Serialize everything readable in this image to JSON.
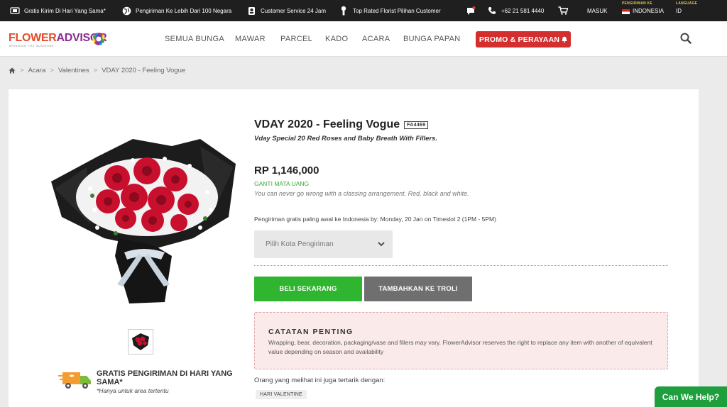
{
  "topbar": {
    "items": [
      {
        "icon": "truck-gift-icon",
        "text": "Gratis Kirim Di Hari Yang Sama*"
      },
      {
        "icon": "globe-icon",
        "text": "Pengiriman Ke Lebih Dari 100 Negara"
      },
      {
        "icon": "headset-icon",
        "text": "Customer Service 24 Jam"
      },
      {
        "icon": "florist-icon",
        "text": "Top Rated Florist Pilihan Customer"
      }
    ],
    "phone": "+62 21 581 4440",
    "login": "MASUK",
    "ship_to_label": "PENGIRIMAN KE",
    "ship_to_value": "INDONESIA",
    "language_label": "LANGUAGE",
    "language_value": "ID"
  },
  "header": {
    "logo_text_1": "FLOWER",
    "logo_text_2": "ADVISOR",
    "logo_tagline": "BRINGING THE SUNSHINE",
    "nav": [
      "SEMUA BUNGA",
      "MAWAR",
      "PARCEL",
      "KADO",
      "ACARA",
      "BUNGA PAPAN"
    ],
    "promo": "PROMO & PERAYAAN"
  },
  "breadcrumb": [
    "Acara",
    "Valentines",
    "VDAY 2020 - Feeling Vogue"
  ],
  "product": {
    "title": "VDAY 2020 - Feeling Vogue",
    "sku": "FA4469",
    "subtitle": "Vday Special 20 Red Roses and Baby Breath With Fillers.",
    "price": "RP 1,146,000",
    "change_currency": "GANTI MATA UANG",
    "description": "You can never go wrong with a classing arrangement. Red, black and white.",
    "delivery": "Pengiriman gratis paling awal ke Indonesia by: Monday, 20 Jan on Timeslot 2 (1PM - 5PM)",
    "city_placeholder": "Pilih Kota Pengiriman",
    "buy_now": "BELI SEKARANG",
    "add_to_cart": "TAMBAHKAN KE TROLI",
    "note_title": "CATATAN PENTING",
    "note_body": "Wrapping, bear, decoration, packaging/vase and fillers may vary. FlowerAdvisor reserves the right to replace any item with another of equivalent value depending on season and availability",
    "others_label": "Orang yang melihat ini juga tertarik dengan:",
    "tag": "HARI VALENTINE"
  },
  "free_shipping": {
    "title": "GRATIS PENGIRIMAN DI HARI YANG SAMA*",
    "note": "*Hanya untuk area tertentu"
  },
  "chat": "Can We Help?",
  "colors": {
    "topbar_bg": "#1f1f1f",
    "promo": "#d32f2f",
    "buy": "#2fb52f",
    "cart": "#6f6f6f",
    "currency_green": "#3aa63a",
    "chat": "#1e9e3c"
  }
}
